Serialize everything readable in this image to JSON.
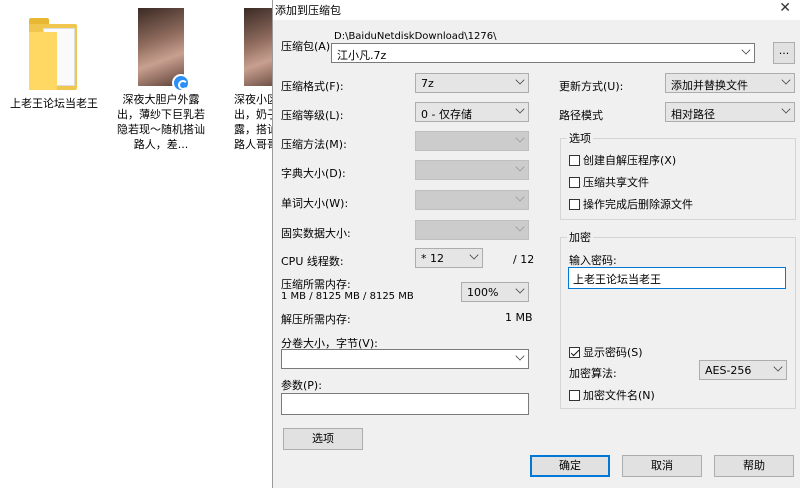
{
  "desktop": {
    "items": [
      {
        "label": "上老王论坛当老王"
      },
      {
        "label": "深夜大胆户外露出，薄纱下巨乳若隐若现～随机搭讪路人，差..."
      },
      {
        "label": "深夜小区出，奶子露，搭讪路人哥哥"
      }
    ]
  },
  "dialog": {
    "title": "添加到压缩包",
    "close": "✕",
    "archive": {
      "label": "压缩包(A)",
      "path": "D:\\BaiduNetdiskDownload\\1276\\",
      "value": "江小凡.7z",
      "browse": "..."
    },
    "left": {
      "format_label": "压缩格式(F):",
      "format_value": "7z",
      "level_label": "压缩等级(L):",
      "level_value": "0 - 仅存储",
      "method_label": "压缩方法(M):",
      "dict_label": "字典大小(D):",
      "word_label": "单词大小(W):",
      "solid_label": "固实数据大小:",
      "cpu_label": "CPU 线程数:",
      "cpu_value": "* 12",
      "cpu_max": "/ 12",
      "mem_label": "压缩所需内存:",
      "mem_detail": "1 MB / 8125 MB / 8125 MB",
      "mem_value": "100%",
      "decomp_label": "解压所需内存:",
      "decomp_value": "1 MB",
      "split_label": "分卷大小，字节(V):",
      "params_label": "参数(P):",
      "options_btn": "选项"
    },
    "right": {
      "update_label": "更新方式(U):",
      "update_value": "添加并替换文件",
      "path_label": "路径模式",
      "path_value": "相对路径",
      "options_group": "选项",
      "opt_sfx": "创建自解压程序(X)",
      "opt_shared": "压缩共享文件",
      "opt_delete": "操作完成后删除源文件",
      "enc_group": "加密",
      "pwd_label": "输入密码:",
      "pwd_value": "上老王论坛当老王",
      "show_pwd": "显示密码(S)",
      "enc_method_label": "加密算法:",
      "enc_method_value": "AES-256",
      "enc_names": "加密文件名(N)"
    },
    "buttons": {
      "ok": "确定",
      "cancel": "取消",
      "help": "帮助"
    }
  }
}
